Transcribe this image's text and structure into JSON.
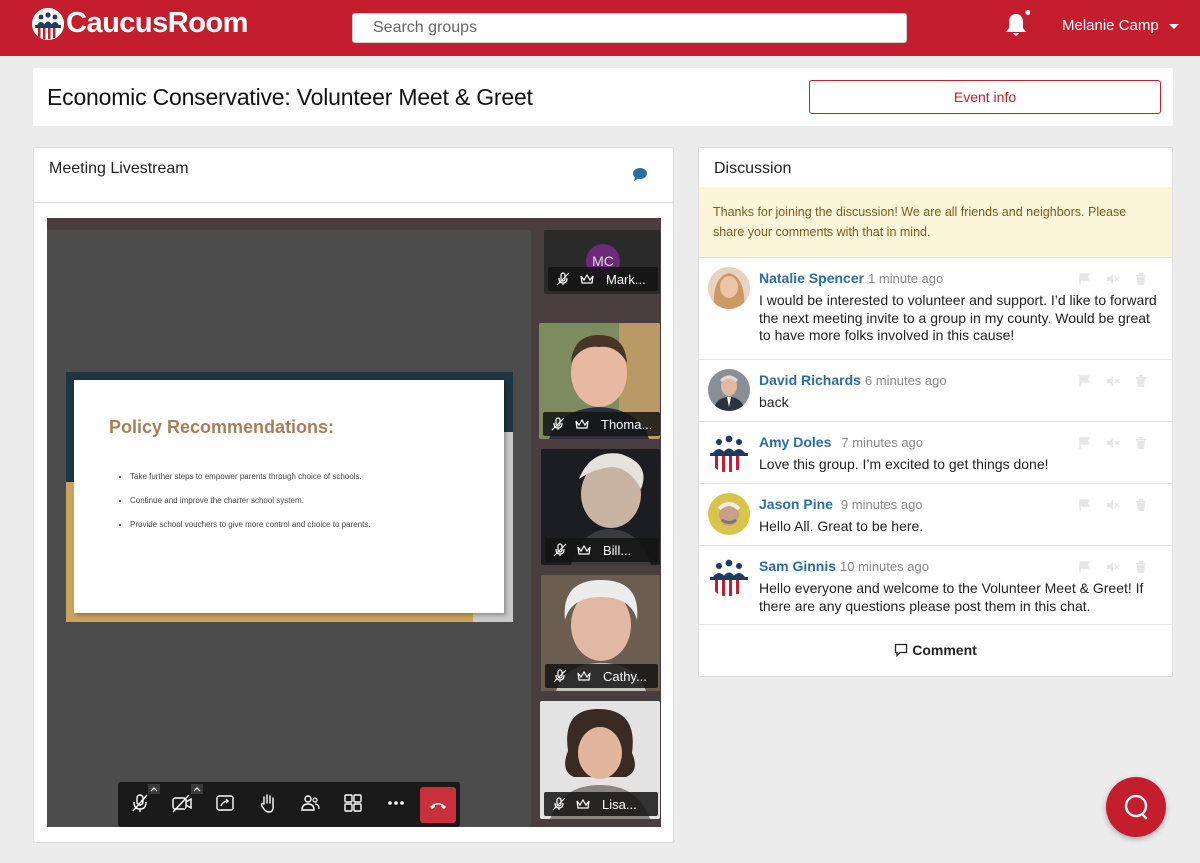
{
  "app": {
    "name": "CaucusRoom",
    "search_placeholder": "Search groups",
    "user_name": "Melanie Camp"
  },
  "page": {
    "title": "Economic Conservative: Volunteer Meet & Greet",
    "event_info_label": "Event info"
  },
  "livestream": {
    "title": "Meeting Livestream",
    "slide": {
      "title": "Policy Recommendations:",
      "bullets": [
        "Take further steps to empower parents through choice of schools.",
        "Continue and improve the charter school system.",
        "Provide school vouchers to give more control and choice to parents."
      ]
    },
    "participants": [
      {
        "initials": "MC",
        "label": "Mark..."
      },
      {
        "label": "Thoma..."
      },
      {
        "label": "Bill..."
      },
      {
        "label": "Cathy..."
      },
      {
        "label": "Lisa..."
      }
    ]
  },
  "discussion": {
    "title": "Discussion",
    "notice": "Thanks for joining the discussion! We are all friends and neighbors. Please share your comments with that in mind.",
    "comments": [
      {
        "name": "Natalie Spencer",
        "time": "1 minute ago",
        "text": "I would be interested to volunteer and support. I’d like to forward the next meeting invite to a group in my county. Would be great to have more folks involved in this cause!"
      },
      {
        "name": "David Richards",
        "time": "6 minutes ago",
        "text": "back"
      },
      {
        "name": "Amy Doles",
        "time": "7 minutes ago",
        "text": "Love this group. I’m excited to get things done!"
      },
      {
        "name": "Jason Pine",
        "time": "9 minutes ago",
        "text": "Hello All. Great to be here."
      },
      {
        "name": "Sam Ginnis",
        "time": "10 minutes ago",
        "text": "Hello everyone and welcome to the Volunteer Meet & Greet! If there are any questions please post them in this chat."
      }
    ],
    "comment_button_label": "Comment"
  },
  "colors": {
    "brand_red": "#c41e2e",
    "link_blue": "#2a6ea6",
    "notice_bg": "#fcf5d9"
  },
  "icons": [
    "logo-icon",
    "bell-icon",
    "chevron-down-icon",
    "chat-icon",
    "mic-off-icon",
    "crown-icon",
    "camera-off-icon",
    "share-screen-icon",
    "raise-hand-icon",
    "participants-icon",
    "grid-icon",
    "more-icon",
    "hang-up-icon",
    "flag-icon",
    "mute-icon",
    "trash-icon",
    "comment-icon",
    "help-chat-icon"
  ]
}
